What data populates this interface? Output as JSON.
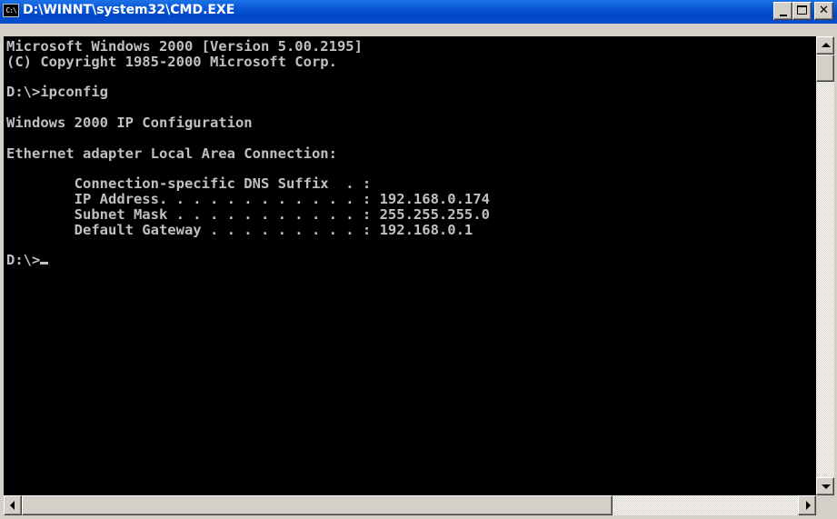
{
  "window": {
    "title": "D:\\WINNT\\system32\\CMD.EXE",
    "icon_label": "C:\\"
  },
  "console": {
    "lines": [
      "Microsoft Windows 2000 [Version 5.00.2195]",
      "(C) Copyright 1985-2000 Microsoft Corp.",
      "",
      "D:\\>ipconfig",
      "",
      "Windows 2000 IP Configuration",
      "",
      "Ethernet adapter Local Area Connection:",
      "",
      "        Connection-specific DNS Suffix  . :",
      "        IP Address. . . . . . . . . . . . : 192.168.0.174",
      "        Subnet Mask . . . . . . . . . . . : 255.255.255.0",
      "        Default Gateway . . . . . . . . . : 192.168.0.1",
      "",
      "D:\\>"
    ]
  },
  "icons": {
    "minimize": "minimize-icon",
    "maximize": "maximize-icon",
    "close": "close-icon",
    "close_glyph": "✕"
  },
  "colors": {
    "console_bg": "#000000",
    "console_fg": "#c0c0c0",
    "titlebar": "#0a57d8"
  }
}
